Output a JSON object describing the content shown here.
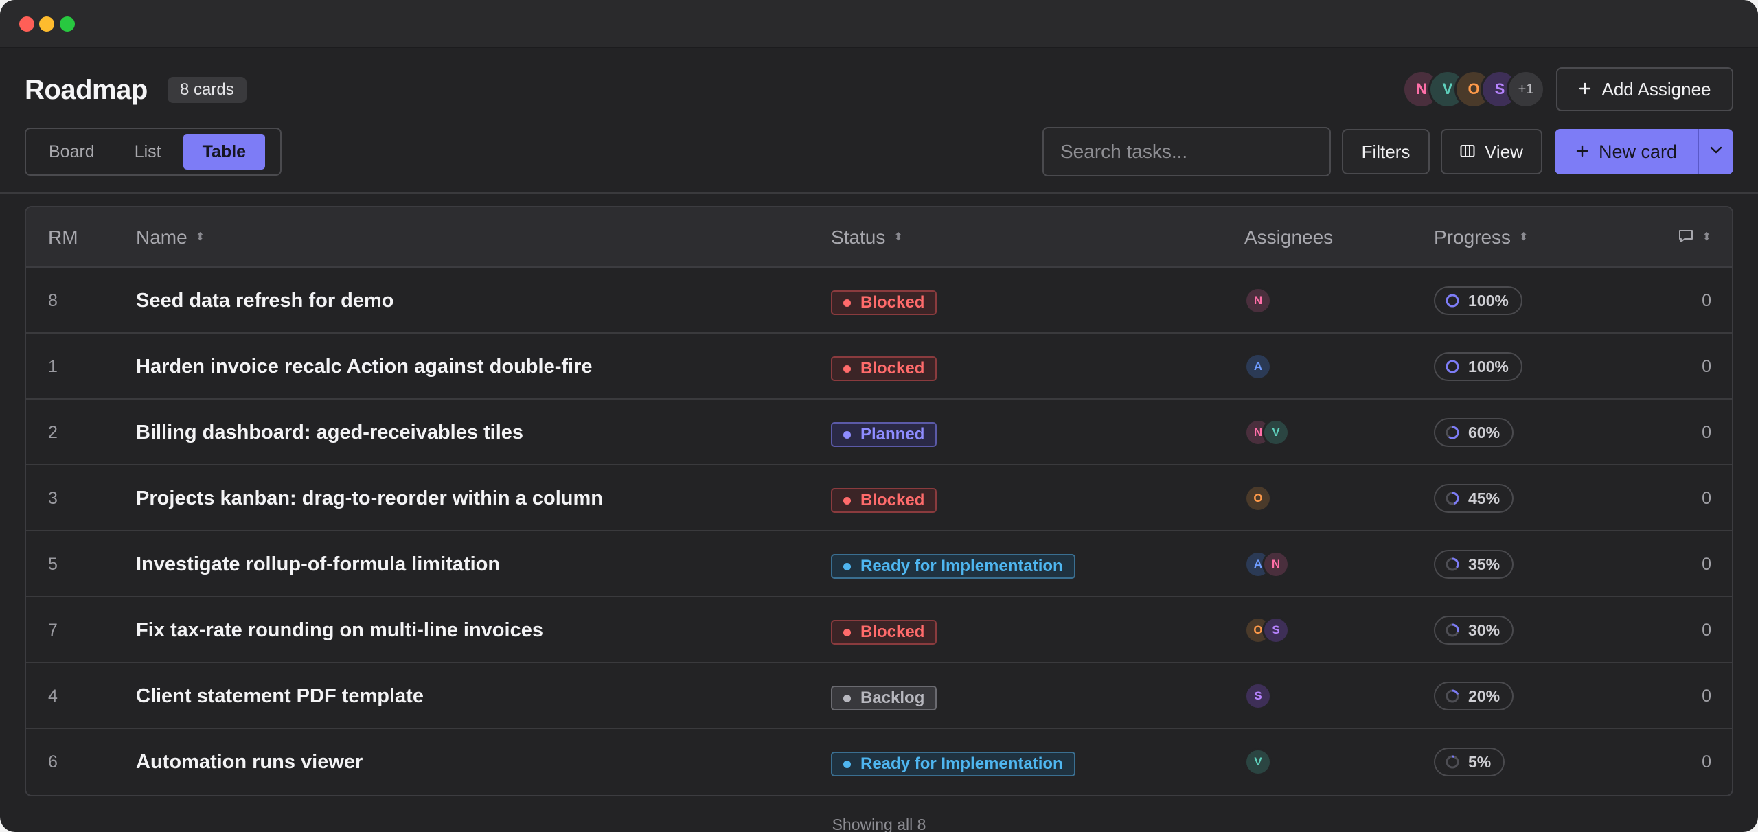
{
  "header": {
    "title": "Roadmap",
    "count_badge": "8 cards",
    "avatars": [
      {
        "initial": "N",
        "bg": "#4a2f3d",
        "fg": "#ff6fa8"
      },
      {
        "initial": "V",
        "bg": "#2b4542",
        "fg": "#5fd0bc"
      },
      {
        "initial": "O",
        "bg": "#4a3a2a",
        "fg": "#ff9a4a"
      },
      {
        "initial": "S",
        "bg": "#3e2f57",
        "fg": "#b784ff"
      }
    ],
    "avatars_more": "+1",
    "add_assignee_label": "Add Assignee"
  },
  "tabs": [
    {
      "label": "Board",
      "active": false
    },
    {
      "label": "List",
      "active": false
    },
    {
      "label": "Table",
      "active": true
    }
  ],
  "toolbar": {
    "search_placeholder": "Search tasks...",
    "filters_label": "Filters",
    "view_label": "View",
    "new_card_label": "New card"
  },
  "table": {
    "columns": {
      "rm": "RM",
      "name": "Name",
      "status": "Status",
      "assignees": "Assignees",
      "progress": "Progress",
      "comments_icon": "comment-icon"
    },
    "rows": [
      {
        "rm": "8",
        "name": "Seed data refresh for demo",
        "status": "Blocked",
        "assignees": [
          "N"
        ],
        "progress_label": "100%",
        "progress": 1.0,
        "comments": "0"
      },
      {
        "rm": "1",
        "name": "Harden invoice recalc Action against double-fire",
        "status": "Blocked",
        "assignees": [
          "A"
        ],
        "progress_label": "100%",
        "progress": 1.0,
        "comments": "0"
      },
      {
        "rm": "2",
        "name": "Billing dashboard: aged-receivables tiles",
        "status": "Planned",
        "assignees": [
          "N",
          "V"
        ],
        "progress_label": "60%",
        "progress": 0.6,
        "comments": "0"
      },
      {
        "rm": "3",
        "name": "Projects kanban: drag-to-reorder within a column",
        "status": "Blocked",
        "assignees": [
          "O"
        ],
        "progress_label": "45%",
        "progress": 0.45,
        "comments": "0"
      },
      {
        "rm": "5",
        "name": "Investigate rollup-of-formula limitation",
        "status": "Ready for Implementation",
        "assignees": [
          "A",
          "N"
        ],
        "progress_label": "35%",
        "progress": 0.35,
        "comments": "0"
      },
      {
        "rm": "7",
        "name": "Fix tax-rate rounding on multi-line invoices",
        "status": "Blocked",
        "assignees": [
          "O",
          "S"
        ],
        "progress_label": "30%",
        "progress": 0.3,
        "comments": "0"
      },
      {
        "rm": "4",
        "name": "Client statement PDF template",
        "status": "Backlog",
        "assignees": [
          "S"
        ],
        "progress_label": "20%",
        "progress": 0.2,
        "comments": "0"
      },
      {
        "rm": "6",
        "name": "Automation runs viewer",
        "status": "Ready for Implementation",
        "assignees": [
          "V"
        ],
        "progress_label": "5%",
        "progress": 0.05,
        "comments": "0"
      }
    ]
  },
  "status_colors": {
    "Blocked": {
      "fg": "#ff6b6b",
      "bg": "#3b2426",
      "border": "#8a3b3e"
    },
    "Planned": {
      "fg": "#8e8cff",
      "bg": "#2a2946",
      "border": "#5b5aa8"
    },
    "Ready for Implementation": {
      "fg": "#4fb6f0",
      "bg": "#1f3240",
      "border": "#3a6f91"
    },
    "Backlog": {
      "fg": "#b7b7be",
      "bg": "#38383c",
      "border": "#6a6a70"
    }
  },
  "avatar_colors": {
    "N": {
      "bg": "#4a2f3d",
      "fg": "#ff6fa8"
    },
    "A": {
      "bg": "#2b3a55",
      "fg": "#6f9cff"
    },
    "V": {
      "bg": "#2b4542",
      "fg": "#5fd0bc"
    },
    "O": {
      "bg": "#4a3a2a",
      "fg": "#ff9a4a"
    },
    "S": {
      "bg": "#3e2f57",
      "fg": "#b784ff"
    }
  },
  "accent": "#7d7cf6",
  "footer": "Showing all 8"
}
